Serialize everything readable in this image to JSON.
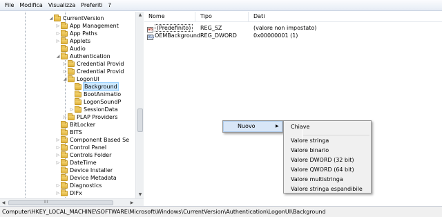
{
  "menubar": {
    "items": [
      "File",
      "Modifica",
      "Visualizza",
      "Preferiti",
      "?"
    ]
  },
  "tree": {
    "items": [
      {
        "label": "CurrentVersion",
        "expanded": true
      },
      {
        "label": "App Management",
        "expanded": false
      },
      {
        "label": "App Paths",
        "expanded": false
      },
      {
        "label": "Applets",
        "expanded": false
      },
      {
        "label": "Audio",
        "expanded": null
      },
      {
        "label": "Authentication",
        "expanded": true
      },
      {
        "label": "Credential Provid",
        "expanded": false
      },
      {
        "label": "Credential Provid",
        "expanded": false
      },
      {
        "label": "LogonUI",
        "expanded": true
      },
      {
        "label": "Background",
        "expanded": null,
        "selected": true
      },
      {
        "label": "BootAnimatio",
        "expanded": null
      },
      {
        "label": "LogonSoundP",
        "expanded": null
      },
      {
        "label": "SessionData",
        "expanded": false
      },
      {
        "label": "PLAP Providers",
        "expanded": false
      },
      {
        "label": "BitLocker",
        "expanded": null
      },
      {
        "label": "BITS",
        "expanded": null
      },
      {
        "label": "Component Based Se",
        "expanded": false
      },
      {
        "label": "Control Panel",
        "expanded": false
      },
      {
        "label": "Controls Folder",
        "expanded": false
      },
      {
        "label": "DateTime",
        "expanded": false
      },
      {
        "label": "Device Installer",
        "expanded": null
      },
      {
        "label": "Device Metadata",
        "expanded": null
      },
      {
        "label": "Diagnostics",
        "expanded": false
      },
      {
        "label": "DIFx",
        "expanded": false
      }
    ],
    "hscroll_grip": "III"
  },
  "values": {
    "columns": [
      "Nome",
      "Tipo",
      "Dati"
    ],
    "rows": [
      {
        "icon": "string-value-icon",
        "icon_text": "ab",
        "name": "(Predefinito)",
        "type": "REG_SZ",
        "data": "(valore non impostato)"
      },
      {
        "icon": "dword-value-icon",
        "icon_text": "011",
        "name": "OEMBackground",
        "type": "REG_DWORD",
        "data": "0x00000001 (1)"
      }
    ]
  },
  "context_menu": {
    "nuovo_label": "Nuovo",
    "submenu": {
      "first": "Chiave",
      "items": [
        "Valore stringa",
        "Valore binario",
        "Valore DWORD (32 bit)",
        "Valore QWORD (64 bit)",
        "Valore multistringa",
        "Valore stringa espandibile"
      ]
    }
  },
  "statusbar": {
    "path": "Computer\\HKEY_LOCAL_MACHINE\\SOFTWARE\\Microsoft\\Windows\\CurrentVersion\\Authentication\\LogonUI\\Background"
  },
  "colors": {
    "selection": "#cce8ff",
    "menu_highlight": "#d8e6f7",
    "folder": "#e0b33c"
  }
}
